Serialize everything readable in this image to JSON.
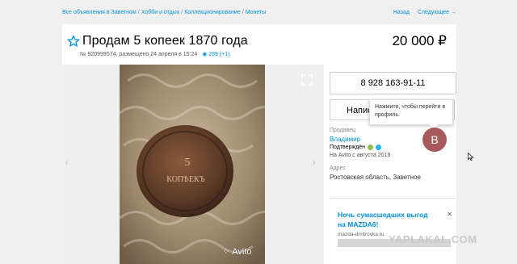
{
  "breadcrumbs": [
    "Все объявления в Заветном",
    "Хобби и отдых",
    "Коллекционирование",
    "Монеты"
  ],
  "breadcrumb_sep": "/",
  "nav": {
    "back": "Назад",
    "next": "Следующее →"
  },
  "listing": {
    "title": "Продам 5 копеек 1870 года",
    "price": "20 000 ₽",
    "meta": "№ 920999574, размещено 24 апреля в 15:24",
    "views": "289 (+1)"
  },
  "gallery": {
    "prev_arrow": "‹",
    "next_arrow": "›",
    "watermark": "Avito",
    "coin_text_top": "5",
    "coin_text_mid": "КОПѢЕКЪ"
  },
  "sidebar": {
    "phone": "8 928 163-91-11",
    "write_button": "Написать",
    "tooltip": "Нажмите, чтобы перейти в профиль.",
    "seller_label": "Продавец",
    "seller_name": "Владимир",
    "verified": "Подтверждён",
    "since": "На Avito с августа 2016",
    "avatar_letter": "В",
    "address_label": "Адрес",
    "address": "Ростовская область, Заветное"
  },
  "ad": {
    "title": "Ночь сумасшедших выгод на MAZDA6!",
    "close": "✕",
    "domain": "mazda-dmitrovka.ru"
  },
  "site_watermark": "YAPLAKAL.COM",
  "colors": {
    "link": "#0091d9",
    "avatar": "#a85a5a",
    "verified_green": "#8bc34a",
    "verified_blue": "#29b6f6"
  }
}
